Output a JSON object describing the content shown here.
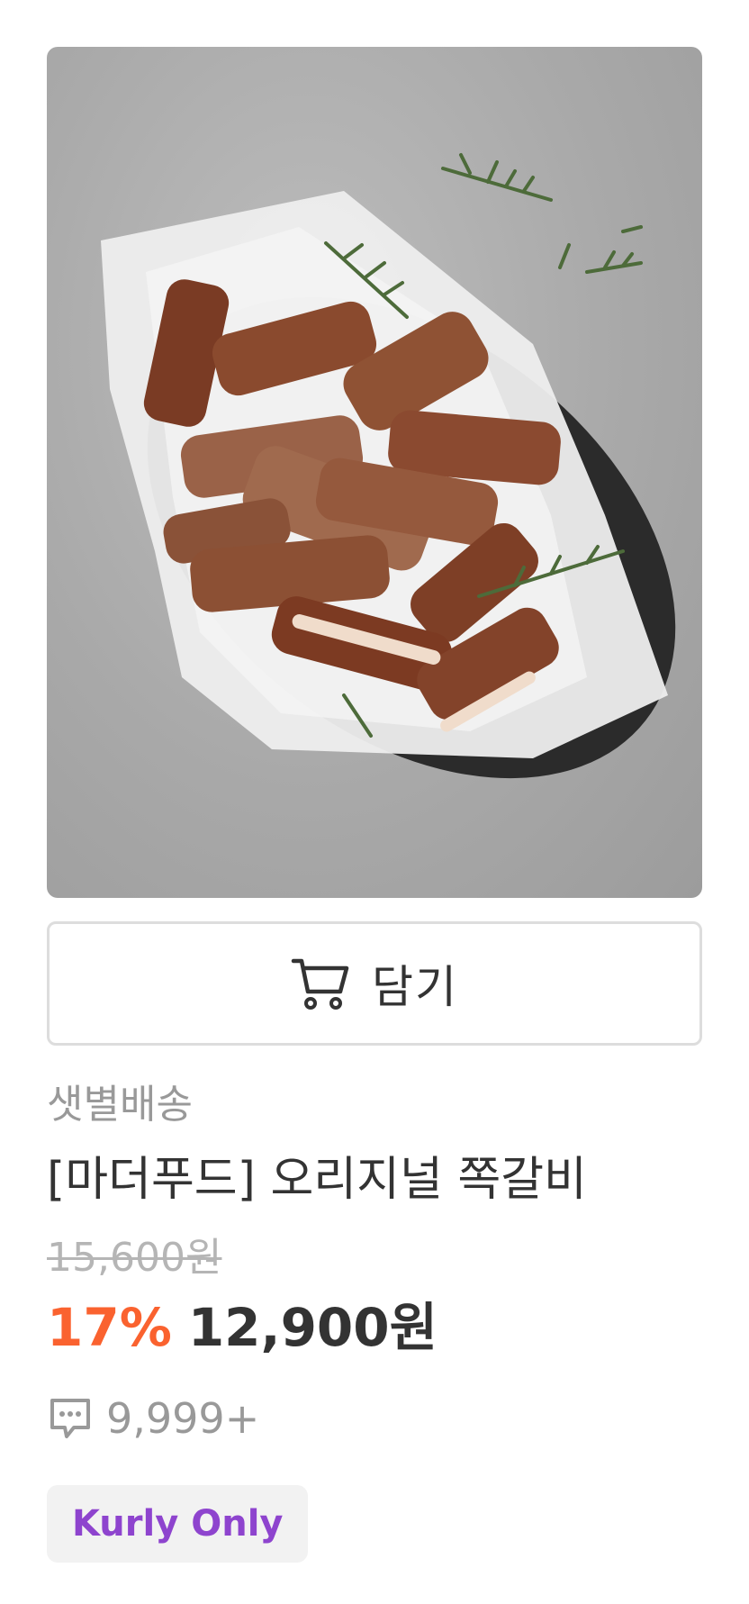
{
  "product": {
    "image_alt": "grilled pork back ribs on a dark plate with parchment and rosemary",
    "cart_button_label": "담기",
    "cart_icon": "cart-icon",
    "delivery_type": "샛별배송",
    "title": "[마더푸드] 오리지널 쪽갈비",
    "original_price": "15,600원",
    "discount_rate": "17%",
    "sale_price": "12,900원",
    "review_icon": "speech-bubble-icon",
    "review_count": "9,999+",
    "badge": "Kurly Only"
  },
  "colors": {
    "discount": "#fa622f",
    "badge_text": "#8e44ce",
    "badge_bg": "#f2f2f2",
    "text_primary": "#333333",
    "text_secondary": "#999999"
  }
}
